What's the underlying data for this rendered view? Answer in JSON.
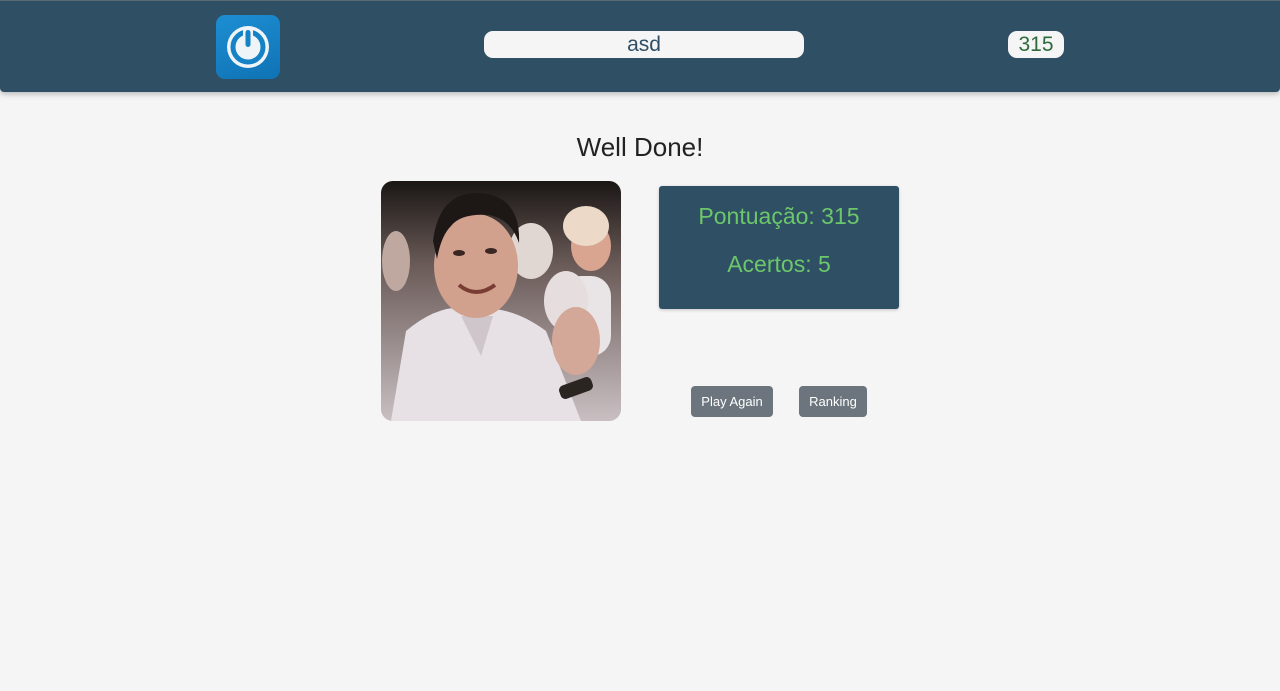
{
  "header": {
    "logo_icon": "power-button-icon",
    "player_name": "asd",
    "score": "315"
  },
  "feedback": {
    "title": "Well Done!",
    "image_icon": "applauding-man-gif",
    "score_label": "Pontuação: 315",
    "hits_label": "Acertos: 5"
  },
  "actions": {
    "play_again_label": "Play Again",
    "ranking_label": "Ranking"
  },
  "colors": {
    "header_bg": "#2f4f65",
    "stat_text": "#6cc76a",
    "score_text": "#2e6b3c",
    "button_bg": "#6c757d",
    "page_bg": "#f5f5f5"
  }
}
